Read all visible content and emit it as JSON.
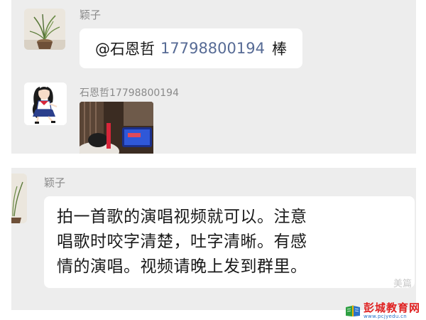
{
  "messages": [
    {
      "sender": "颖子",
      "avatar": "potted-plant-avatar",
      "mention": "@石恩哲",
      "mention_phone": "17798800194",
      "text": "棒"
    },
    {
      "sender": "石恩哲17798800194",
      "avatar": "anime-girl-avatar",
      "attachment": "video-thumbnail"
    },
    {
      "sender": "颖子",
      "avatar": "potted-plant-avatar",
      "lines": [
        "拍一首歌的演唱视频就可以。注意",
        "唱歌时咬字清楚，吐字清晰。有感",
        "情的演唱。视频请晚上发到群里。"
      ]
    }
  ],
  "watermark": {
    "title": "彭城教育网",
    "url": "www.pcjyedu.cn",
    "faint": "美篇"
  },
  "colors": {
    "chat_background": "#ededed",
    "bubble": "#ffffff",
    "mention_link": "#576b95",
    "sender_name": "#8a8a8a",
    "watermark_red": "#e02020"
  }
}
